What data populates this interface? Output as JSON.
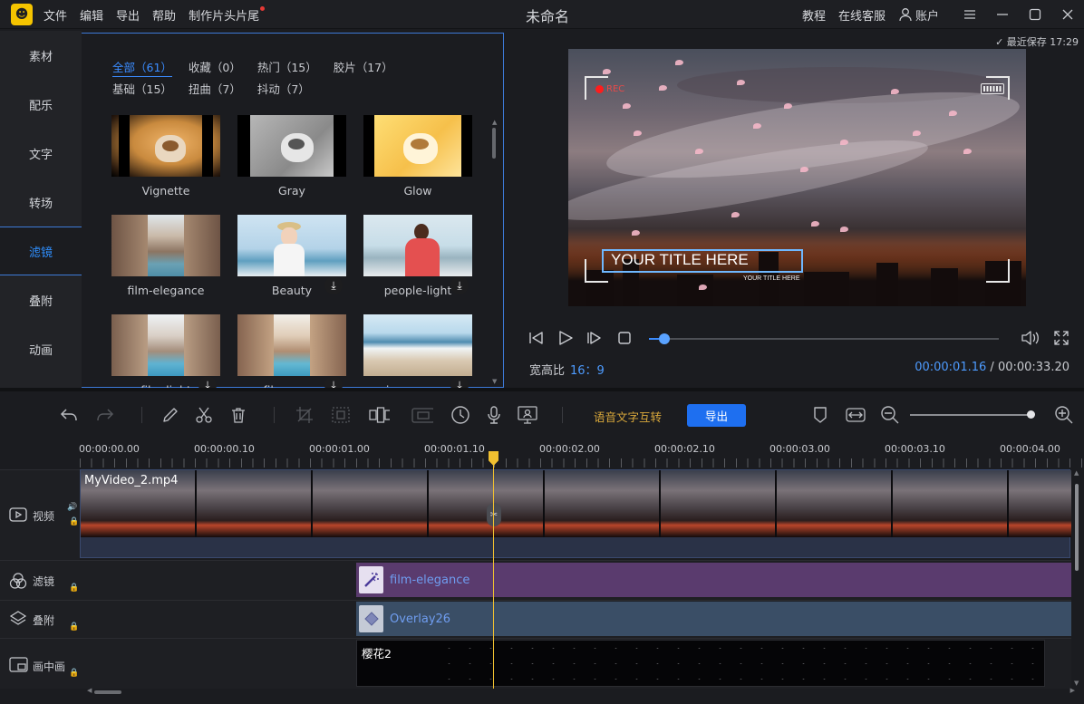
{
  "app": {
    "logo_glyph": "☻",
    "title": "未命名",
    "menu": [
      "文件",
      "编辑",
      "导出",
      "帮助",
      "制作片头片尾"
    ],
    "tutorial": "教程",
    "support": "在线客服",
    "account": "账户"
  },
  "sidebar": {
    "tabs": [
      "素材",
      "配乐",
      "文字",
      "转场",
      "滤镜",
      "叠附",
      "动画"
    ],
    "active": "滤镜"
  },
  "library": {
    "categories": [
      "全部（61）",
      "收藏（0）",
      "热门（15）",
      "胶片（17）",
      "基础（15）",
      "扭曲（7）",
      "抖动（7）"
    ],
    "active_category": "全部（61）",
    "items": [
      {
        "label": "Vignette",
        "downloadable": false
      },
      {
        "label": "Gray",
        "downloadable": false
      },
      {
        "label": "Glow",
        "downloadable": false
      },
      {
        "label": "film-elegance",
        "downloadable": false
      },
      {
        "label": "Beauty",
        "downloadable": true
      },
      {
        "label": "people-light",
        "downloadable": true
      },
      {
        "label": "film-light",
        "downloadable": true
      },
      {
        "label": "film-warm",
        "downloadable": true
      },
      {
        "label": "view-summer",
        "downloadable": true
      }
    ]
  },
  "preview": {
    "last_saved": "最近保存 17:29",
    "overlay_rec": "REC",
    "overlay_title": "YOUR TITLE HERE",
    "overlay_subtitle": "YOUR TITLE HERE",
    "aspect_label": "宽高比",
    "aspect_value": "16：9",
    "current_time": "00:00:01.16",
    "separator": "/",
    "total_time": "00:00:33.20",
    "progress_fraction": 0.045
  },
  "toolbar": {
    "speech_to_text": "语音文字互转",
    "export": "导出",
    "zoom_fraction": 0.95
  },
  "timeline": {
    "ruler": [
      "00:00:00.00",
      "00:00:00.10",
      "00:00:01.00",
      "00:00:01.10",
      "00:00:02.00",
      "00:00:02.10",
      "00:00:03.00",
      "00:00:03.10",
      "00:00:04.00"
    ],
    "tracks": {
      "video": {
        "label": "视频",
        "clip": "MyVideo_2.mp4"
      },
      "filter": {
        "label": "滤镜",
        "clip": "film-elegance"
      },
      "overlay": {
        "label": "叠附",
        "clip": "Overlay26"
      },
      "pip": {
        "label": "画中画",
        "clip": "樱花2"
      }
    }
  },
  "colors": {
    "accent": "#3b8cff",
    "export_button": "#1e6ff0",
    "playhead": "#f0c030",
    "filter_track": "#5a3b6e",
    "overlay_track": "#3a4e66",
    "speech_text": "#d9a83b"
  }
}
